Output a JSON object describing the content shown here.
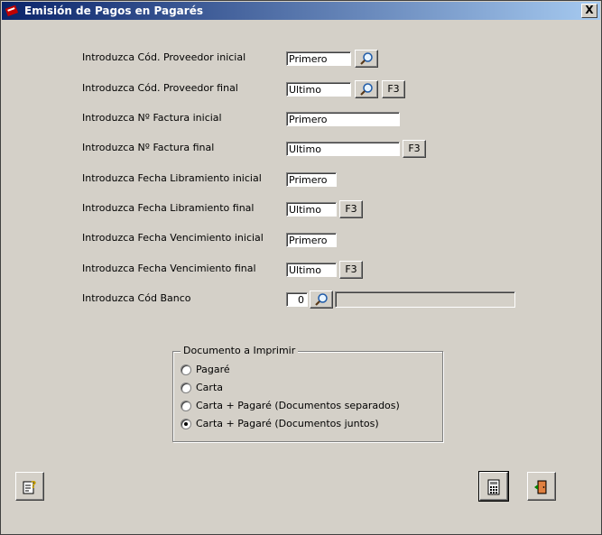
{
  "window": {
    "title": "Emisión de Pagos en Pagarés",
    "close_label": "X"
  },
  "form": {
    "prov_ini": {
      "label": "Introduzca Cód. Proveedor inicial",
      "value": "Primero"
    },
    "prov_fin": {
      "label": "Introduzca Cód. Proveedor final",
      "value": "Ultimo"
    },
    "fact_ini": {
      "label": "Introduzca Nº Factura inicial",
      "value": "Primero"
    },
    "fact_fin": {
      "label": "Introduzca Nº Factura final",
      "value": "Ultimo"
    },
    "lib_ini": {
      "label": "Introduzca Fecha Libramiento inicial",
      "value": "Primero"
    },
    "lib_fin": {
      "label": "Introduzca Fecha Libramiento final",
      "value": "Ultimo"
    },
    "ven_ini": {
      "label": "Introduzca Fecha Vencimiento inicial",
      "value": "Primero"
    },
    "ven_fin": {
      "label": "Introduzca Fecha Vencimiento final",
      "value": "Ultimo"
    },
    "banco": {
      "label": "Introduzca Cód Banco",
      "value": "0",
      "name": ""
    },
    "f3_label": "F3"
  },
  "documento": {
    "title": "Documento a Imprimir",
    "options": [
      {
        "label": "Pagaré",
        "selected": false
      },
      {
        "label": "Carta",
        "selected": false
      },
      {
        "label": "Carta + Pagaré (Documentos separados)",
        "selected": false
      },
      {
        "label": "Carta + Pagaré (Documentos juntos)",
        "selected": true
      }
    ]
  },
  "icons": {
    "search": "magnifier-icon",
    "help": "help-icon",
    "print": "calculator-icon",
    "exit": "exit-door-icon"
  }
}
